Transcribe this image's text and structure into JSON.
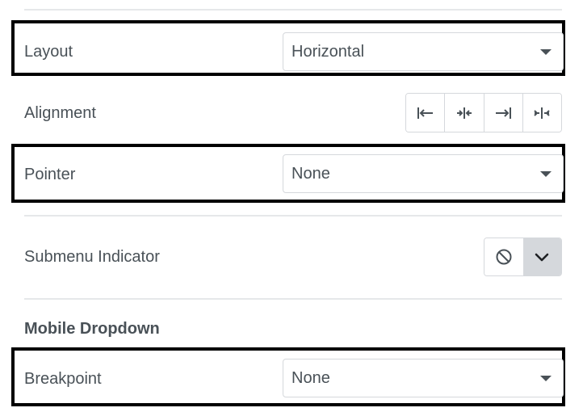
{
  "layout": {
    "label": "Layout",
    "value": "Horizontal"
  },
  "alignment": {
    "label": "Alignment",
    "options": [
      "align-start-icon",
      "align-center-icon",
      "align-end-icon",
      "align-justify-icon"
    ]
  },
  "pointer": {
    "label": "Pointer",
    "value": "None"
  },
  "submenu_indicator": {
    "label": "Submenu Indicator",
    "selected": "ban-icon",
    "toggle": "chevron-down-icon"
  },
  "mobile_dropdown": {
    "section_title": "Mobile Dropdown",
    "breakpoint": {
      "label": "Breakpoint",
      "value": "None"
    }
  },
  "colors": {
    "text": "#495157",
    "border": "#d5d8dc",
    "highlight": "#000000",
    "active_segment": "#d5d8dc"
  }
}
